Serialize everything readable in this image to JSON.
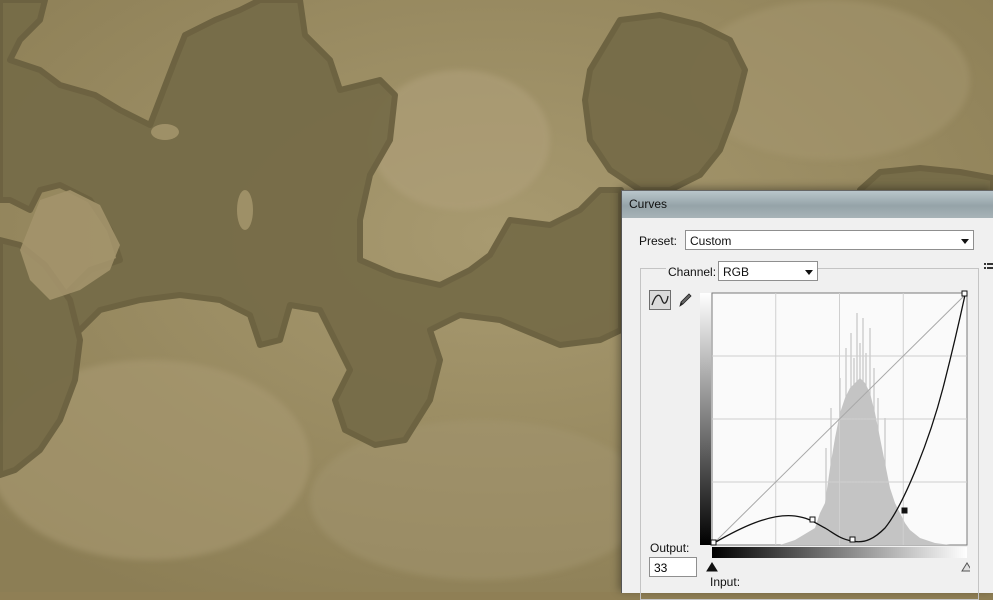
{
  "dialog": {
    "title": "Curves",
    "preset_label": "Preset:",
    "preset_value": "Custom",
    "channel_label": "Channel:",
    "channel_value": "RGB",
    "output_label": "Output:",
    "output_value": "33",
    "input_label": "Input:"
  },
  "icons": {
    "curve_tool": "curve-point-icon",
    "pencil_tool": "pencil-icon",
    "preset_menu": "preset-options-icon",
    "black_slider": "black-point-triangle-icon",
    "white_slider": "white-point-triangle-icon"
  },
  "colors": {
    "map_land": "#756b47",
    "map_sea": "#a8976d",
    "dialog_bg": "#f0f0f0"
  }
}
